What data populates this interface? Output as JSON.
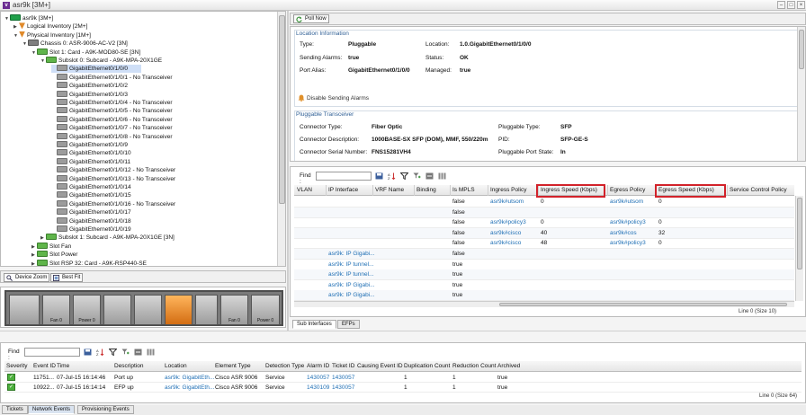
{
  "window": {
    "title": "asr9k [3M+]",
    "logo_letter": "v",
    "controls": [
      "–",
      "□",
      "×"
    ]
  },
  "tree": {
    "items": [
      {
        "label": "asr9k [3M+]",
        "indent": 4,
        "icon": "asr",
        "toggle": "▼"
      },
      {
        "label": "Logical Inventory [2M+]",
        "indent": 14,
        "icon": "logi",
        "toggle": "▶"
      },
      {
        "label": "Physical Inventory [1M+]",
        "indent": 14,
        "icon": "logi",
        "toggle": "▼"
      },
      {
        "label": "Chassis 0: ASR-9006-AC-V2 [3N]",
        "indent": 24,
        "icon": "chas",
        "toggle": "▼"
      },
      {
        "label": "Slot 1: Card - A9K-MOD80-SE [3N]",
        "indent": 34,
        "icon": "card",
        "toggle": "▼"
      },
      {
        "label": "Subslot 0: Subcard - A9K-MPA-20X1GE",
        "indent": 44,
        "icon": "card",
        "toggle": "▼"
      },
      {
        "label": "GigabitEthernet0/1/0/0",
        "indent": 56,
        "icon": "port",
        "toggle": "",
        "selected": true
      },
      {
        "label": "GigabitEthernet0/1/0/1 - No Transceiver",
        "indent": 56,
        "icon": "port",
        "toggle": ""
      },
      {
        "label": "GigabitEthernet0/1/0/2",
        "indent": 56,
        "icon": "port",
        "toggle": ""
      },
      {
        "label": "GigabitEthernet0/1/0/3",
        "indent": 56,
        "icon": "port",
        "toggle": ""
      },
      {
        "label": "GigabitEthernet0/1/0/4 - No Transceiver",
        "indent": 56,
        "icon": "port",
        "toggle": ""
      },
      {
        "label": "GigabitEthernet0/1/0/5 - No Transceiver",
        "indent": 56,
        "icon": "port",
        "toggle": ""
      },
      {
        "label": "GigabitEthernet0/1/0/6 - No Transceiver",
        "indent": 56,
        "icon": "port",
        "toggle": ""
      },
      {
        "label": "GigabitEthernet0/1/0/7 - No Transceiver",
        "indent": 56,
        "icon": "port",
        "toggle": ""
      },
      {
        "label": "GigabitEthernet0/1/0/8 - No Transceiver",
        "indent": 56,
        "icon": "port",
        "toggle": ""
      },
      {
        "label": "GigabitEthernet0/1/0/9",
        "indent": 56,
        "icon": "port",
        "toggle": ""
      },
      {
        "label": "GigabitEthernet0/1/0/10",
        "indent": 56,
        "icon": "port",
        "toggle": ""
      },
      {
        "label": "GigabitEthernet0/1/0/11",
        "indent": 56,
        "icon": "port",
        "toggle": ""
      },
      {
        "label": "GigabitEthernet0/1/0/12 - No Transceiver",
        "indent": 56,
        "icon": "port",
        "toggle": ""
      },
      {
        "label": "GigabitEthernet0/1/0/13 - No Transceiver",
        "indent": 56,
        "icon": "port",
        "toggle": ""
      },
      {
        "label": "GigabitEthernet0/1/0/14",
        "indent": 56,
        "icon": "port",
        "toggle": ""
      },
      {
        "label": "GigabitEthernet0/1/0/15",
        "indent": 56,
        "icon": "port",
        "toggle": ""
      },
      {
        "label": "GigabitEthernet0/1/0/16 - No Transceiver",
        "indent": 56,
        "icon": "port",
        "toggle": ""
      },
      {
        "label": "GigabitEthernet0/1/0/17",
        "indent": 56,
        "icon": "port",
        "toggle": ""
      },
      {
        "label": "GigabitEthernet0/1/0/18",
        "indent": 56,
        "icon": "port",
        "toggle": ""
      },
      {
        "label": "GigabitEthernet0/1/0/19",
        "indent": 56,
        "icon": "port",
        "toggle": ""
      },
      {
        "label": "Subslot 1: Subcard - A9K-MPA-20X1GE [3N]",
        "indent": 44,
        "icon": "card",
        "toggle": "▶"
      },
      {
        "label": "Slot Fan",
        "indent": 34,
        "icon": "card",
        "toggle": "▶"
      },
      {
        "label": "Slot Power",
        "indent": 34,
        "icon": "card",
        "toggle": "▶"
      },
      {
        "label": "Slot RSP 32: Card - A9K-RSP440-SE",
        "indent": 34,
        "icon": "card",
        "toggle": "▶"
      }
    ]
  },
  "device_toolbar": {
    "zoom_label": "Device Zoom",
    "bestfit_label": "Best Fit"
  },
  "device_view": {
    "modules": [
      {
        "label": "",
        "hl": false
      },
      {
        "label": "Fan 0",
        "hl": false
      },
      {
        "label": "Power 0",
        "hl": false
      },
      {
        "label": "",
        "hl": false
      },
      {
        "label": "",
        "hl": false
      },
      {
        "label": "",
        "hl": true
      },
      {
        "label": "",
        "hl": false
      },
      {
        "label": "Fan 0",
        "hl": false
      },
      {
        "label": "Power 0",
        "hl": false
      }
    ]
  },
  "right_toolbar": {
    "poll_label": "Poll Now"
  },
  "location": {
    "title": "Location Information",
    "type_label": "Type:",
    "type_value": "Pluggable",
    "alarms_label": "Sending Alarms:",
    "alarms_value": "true",
    "alias_label": "Port Alias:",
    "alias_value": "GigabitEthernet0/1/0/0",
    "location_label": "Location:",
    "location_value": "1.0.GigabitEthernet0/1/0/0",
    "status_label": "Status:",
    "status_value": "OK",
    "managed_label": "Managed:",
    "managed_value": "true",
    "disable_link": "Disable Sending Alarms"
  },
  "pluggable": {
    "title": "Pluggable Transceiver",
    "ctype_label": "Connector Type:",
    "ctype_value": "Fiber Optic",
    "cdesc_label": "Connector Description:",
    "cdesc_value": "1000BASE-SX SFP (DOM), MMF, 550/220m",
    "serial_label": "Connector Serial Number:",
    "serial_value": "FNS15281VH4",
    "ptype_label": "Pluggable Type:",
    "ptype_value": "SFP",
    "pid_label": "PID:",
    "pid_value": "SFP-GE-S",
    "pstate_label": "Pluggable Port State:",
    "pstate_value": "In"
  },
  "interfaces": {
    "find_label": "Find :",
    "columns": [
      "VLAN",
      "IP Interface",
      "VRF Name",
      "Binding",
      "Is MPLS",
      "Ingress Policy",
      "Ingress Speed (Kbps)",
      "Egress Policy",
      "Egress Speed (Kbps)",
      "Service Control Policy"
    ],
    "rows": [
      [
        "",
        "",
        "",
        "",
        "false",
        "asr9k#utsom",
        "0",
        "asr9k#utsom",
        "0",
        ""
      ],
      [
        "",
        "",
        "",
        "",
        "false",
        "",
        "",
        "",
        "",
        ""
      ],
      [
        "",
        "",
        "",
        "",
        "false",
        "asr9k#policy3",
        "0",
        "asr9k#policy3",
        "0",
        ""
      ],
      [
        "",
        "",
        "",
        "",
        "false",
        "asr9k#cisco",
        "40",
        "asr9k#cos",
        "32",
        ""
      ],
      [
        "",
        "",
        "",
        "",
        "false",
        "asr9k#cisco",
        "48",
        "asr9k#policy3",
        "0",
        ""
      ],
      [
        "",
        "asr9k: IP Gigabi...",
        "",
        "",
        "false",
        "",
        "",
        "",
        "",
        ""
      ],
      [
        "",
        "asr9k: IP tunnel...",
        "",
        "",
        "true",
        "",
        "",
        "",
        "",
        ""
      ],
      [
        "",
        "asr9k: IP tunnel...",
        "",
        "",
        "true",
        "",
        "",
        "",
        "",
        ""
      ],
      [
        "",
        "asr9k: IP Gigabi...",
        "",
        "",
        "true",
        "",
        "",
        "",
        "",
        ""
      ],
      [
        "",
        "asr9k: IP Gigabi...",
        "",
        "",
        "true",
        "",
        "",
        "",
        "",
        ""
      ]
    ],
    "status": "Line 0 (Size 10)",
    "tabs": [
      "Sub Interfaces",
      "EFPs"
    ]
  },
  "events": {
    "find_label": "Find :",
    "columns": [
      "Severity",
      "Event ID",
      "Time",
      "Description",
      "Location",
      "Element Type",
      "Detection Type",
      "Alarm ID",
      "Ticket ID",
      "Causing Event ID",
      "Duplication Count",
      "Reduction Count",
      "Archived"
    ],
    "rows": [
      [
        "",
        "11751...",
        "07-Jul-15 16:14:46",
        "Port up",
        "asr9k: GigabitEth...",
        "Cisco ASR 9006",
        "Service",
        "1430057",
        "1430057",
        "",
        "1",
        "1",
        "true"
      ],
      [
        "",
        "10922...",
        "07-Jul-15 16:14:14",
        "EFP up",
        "asr9k: GigabitEth...",
        "Cisco ASR 9006",
        "Service",
        "1430109",
        "1430057",
        "",
        "1",
        "1",
        "true"
      ]
    ],
    "status": "Line 0 (Size 64)"
  },
  "bottom_tabs": [
    "Tickets",
    "Network Events",
    "Provisioning Events"
  ]
}
